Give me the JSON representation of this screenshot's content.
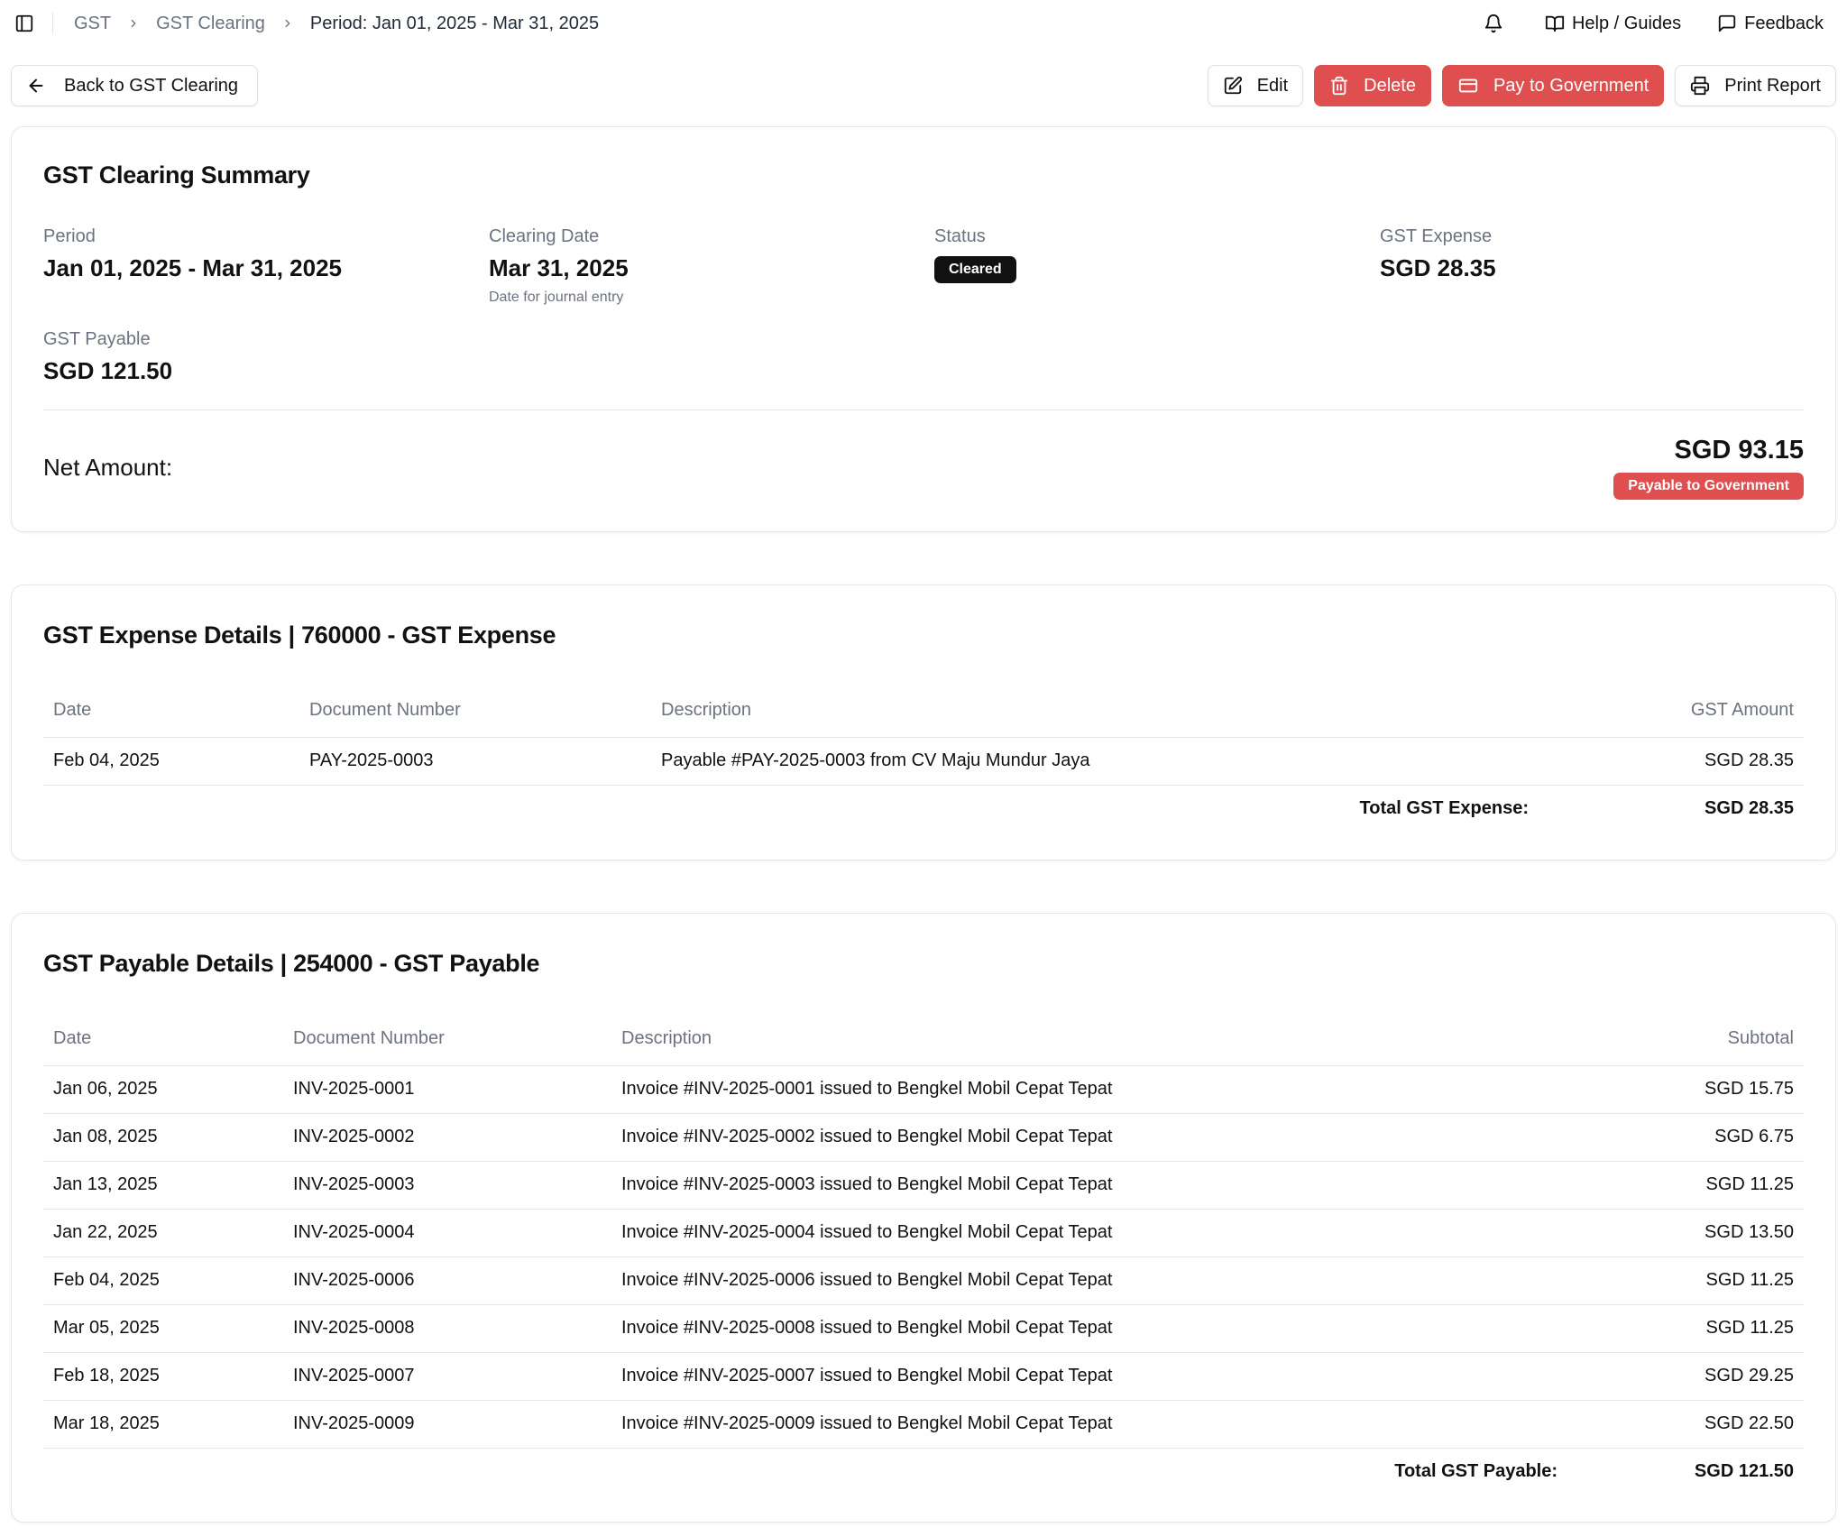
{
  "breadcrumb": {
    "items": [
      "GST",
      "GST Clearing"
    ],
    "current": "Period: Jan 01, 2025 - Mar 31, 2025"
  },
  "topbar": {
    "help_label": "Help / Guides",
    "feedback_label": "Feedback"
  },
  "actions": {
    "back_label": "Back to GST Clearing",
    "edit_label": "Edit",
    "delete_label": "Delete",
    "pay_label": "Pay to Government",
    "print_label": "Print Report"
  },
  "summary": {
    "title": "GST Clearing Summary",
    "period_label": "Period",
    "period_value": "Jan 01, 2025 - Mar 31, 2025",
    "clearing_date_label": "Clearing Date",
    "clearing_date_value": "Mar 31, 2025",
    "clearing_date_hint": "Date for journal entry",
    "status_label": "Status",
    "status_value": "Cleared",
    "gst_expense_label": "GST Expense",
    "gst_expense_value": "SGD 28.35",
    "gst_payable_label": "GST Payable",
    "gst_payable_value": "SGD 121.50",
    "net_label": "Net Amount:",
    "net_value": "SGD 93.15",
    "net_badge": "Payable to Government"
  },
  "expense": {
    "title": "GST Expense Details | 760000 - GST Expense",
    "columns": [
      "Date",
      "Document Number",
      "Description",
      "GST Amount"
    ],
    "rows": [
      {
        "date": "Feb 04, 2025",
        "doc": "PAY-2025-0003",
        "desc": "Payable #PAY-2025-0003 from CV Maju Mundur Jaya",
        "amount": "SGD 28.35"
      }
    ],
    "total_label": "Total GST Expense:",
    "total_value": "SGD 28.35"
  },
  "payable": {
    "title": "GST Payable Details | 254000 - GST Payable",
    "columns": [
      "Date",
      "Document Number",
      "Description",
      "Subtotal"
    ],
    "rows": [
      {
        "date": "Jan 06, 2025",
        "doc": "INV-2025-0001",
        "desc": "Invoice #INV-2025-0001 issued to Bengkel Mobil Cepat Tepat",
        "amount": "SGD 15.75"
      },
      {
        "date": "Jan 08, 2025",
        "doc": "INV-2025-0002",
        "desc": "Invoice #INV-2025-0002 issued to Bengkel Mobil Cepat Tepat",
        "amount": "SGD 6.75"
      },
      {
        "date": "Jan 13, 2025",
        "doc": "INV-2025-0003",
        "desc": "Invoice #INV-2025-0003 issued to Bengkel Mobil Cepat Tepat",
        "amount": "SGD 11.25"
      },
      {
        "date": "Jan 22, 2025",
        "doc": "INV-2025-0004",
        "desc": "Invoice #INV-2025-0004 issued to Bengkel Mobil Cepat Tepat",
        "amount": "SGD 13.50"
      },
      {
        "date": "Feb 04, 2025",
        "doc": "INV-2025-0006",
        "desc": "Invoice #INV-2025-0006 issued to Bengkel Mobil Cepat Tepat",
        "amount": "SGD 11.25"
      },
      {
        "date": "Mar 05, 2025",
        "doc": "INV-2025-0008",
        "desc": "Invoice #INV-2025-0008 issued to Bengkel Mobil Cepat Tepat",
        "amount": "SGD 11.25"
      },
      {
        "date": "Feb 18, 2025",
        "doc": "INV-2025-0007",
        "desc": "Invoice #INV-2025-0007 issued to Bengkel Mobil Cepat Tepat",
        "amount": "SGD 29.25"
      },
      {
        "date": "Mar 18, 2025",
        "doc": "INV-2025-0009",
        "desc": "Invoice #INV-2025-0009 issued to Bengkel Mobil Cepat Tepat",
        "amount": "SGD 22.50"
      }
    ],
    "total_label": "Total GST Payable:",
    "total_value": "SGD 121.50"
  },
  "icons": {
    "sidebar_toggle": "sidebar-toggle-icon",
    "bell": "bell-icon",
    "help": "book-open-icon",
    "feedback": "message-square-icon",
    "back": "arrow-left-icon",
    "edit": "edit-icon",
    "delete": "trash-icon",
    "pay": "credit-card-icon",
    "print": "printer-icon"
  },
  "colors": {
    "danger": "#e04f4f",
    "status_badge_bg": "#111111",
    "muted_text": "#6b7280",
    "border": "#e5e7eb"
  }
}
